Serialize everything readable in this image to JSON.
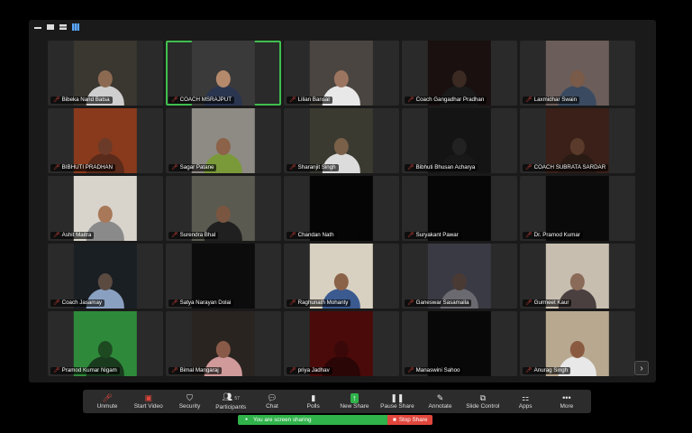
{
  "participants": [
    {
      "name": "Bibeka Nand Batsa",
      "muted": true,
      "video": "#3a3630",
      "skin": "#8c6a52",
      "shirt": "#cfcfcf"
    },
    {
      "name": "COACH MSRAJPUT",
      "muted": true,
      "video": "#3b3a3a",
      "skin": "#b58a6c",
      "shirt": "#2a3550",
      "active": true
    },
    {
      "name": "Lilian Bansal",
      "muted": true,
      "video": "#4a4540",
      "skin": "#9c7560",
      "shirt": "#e8e8e8"
    },
    {
      "name": "Coach Gangadhar Pradhan",
      "muted": true,
      "video": "#1a1010",
      "skin": "#3a2a22",
      "shirt": "#1a1a1a"
    },
    {
      "name": "Laxmidhar Swain",
      "muted": true,
      "video": "#6b5d59",
      "skin": "#7a5a48",
      "shirt": "#3a4a60"
    },
    {
      "name": "BIBHUTI PRADHAN",
      "muted": true,
      "video": "#8a3a1c",
      "skin": "#6b3a28",
      "shirt": "#5a2a1a"
    },
    {
      "name": "Sagar Patane",
      "muted": true,
      "video": "#8e8a84",
      "skin": "#8c6248",
      "shirt": "#7a9a3a"
    },
    {
      "name": "Sharanjit Singh",
      "muted": true,
      "video": "#3a3a30",
      "skin": "#7a6048",
      "shirt": "#dcdcdc"
    },
    {
      "name": "Bibhuti Bhusan Acharya",
      "muted": true,
      "video": "#141414",
      "skin": "#222",
      "shirt": "#181818"
    },
    {
      "name": "COACH SUBRATA SARDAR",
      "muted": true,
      "video": "#3a2018",
      "skin": "#5a3a2a",
      "shirt": "#2a1a14"
    },
    {
      "name": "Ashit Maitra",
      "muted": true,
      "video": "#d8d4cc",
      "skin": "#a87858",
      "shirt": "#8a8a8a"
    },
    {
      "name": "Surendra Bhal",
      "muted": true,
      "video": "#5a5a50",
      "skin": "#7a5640",
      "shirt": "#202020"
    },
    {
      "name": "Chandan Nath",
      "muted": true,
      "video": "#050505",
      "skin": "#050505",
      "shirt": "#050505"
    },
    {
      "name": "Suryakant Pawar",
      "muted": true,
      "video": "#060606",
      "skin": "#060606",
      "shirt": "#060606"
    },
    {
      "name": "Dr. Pramod Kumar",
      "muted": true,
      "video": "#0a0a0a",
      "skin": "#0a0a0a",
      "shirt": "#0a0a0a"
    },
    {
      "name": "Coach Jasamay",
      "muted": true,
      "video": "#1a1f24",
      "skin": "#5a4a40",
      "shirt": "#8aa0c0"
    },
    {
      "name": "Satya Narayan Dolai",
      "muted": true,
      "video": "#0c0c0c",
      "skin": "#0c0c0c",
      "shirt": "#0c0c0c"
    },
    {
      "name": "Raghunath Mohanty",
      "muted": true,
      "video": "#d8d0c0",
      "skin": "#8a6248",
      "shirt": "#3a5a90"
    },
    {
      "name": "Ganeswar Sasamalla",
      "muted": true,
      "video": "#3a3a44",
      "skin": "#4a3a34",
      "shirt": "#6a6a70"
    },
    {
      "name": "Gurmeet Kaur",
      "muted": true,
      "video": "#c8beb0",
      "skin": "#8a6a58",
      "shirt": "#4a4040"
    },
    {
      "name": "Pramod Kumar Nigam",
      "muted": true,
      "video": "#2e8a3a",
      "skin": "#1e4a22",
      "shirt": "#1a3a1e"
    },
    {
      "name": "Bimal Mangaraj",
      "muted": true,
      "video": "#2a2420",
      "skin": "#8a5a48",
      "shirt": "#d09a9a"
    },
    {
      "name": "priya Jadhav",
      "muted": true,
      "video": "#4a0a0a",
      "skin": "#3a0808",
      "shirt": "#2a0606"
    },
    {
      "name": "Manaswini Sahoo",
      "muted": true,
      "video": "#080808",
      "skin": "#080808",
      "shirt": "#080808"
    },
    {
      "name": "Anurag Singh",
      "muted": true,
      "video": "#b8a890",
      "skin": "#8a5a40",
      "shirt": "#e8e8e8"
    }
  ],
  "toolbar": {
    "unmute": "Unmute",
    "start_video": "Start Video",
    "security": "Security",
    "participants": "Participants",
    "participants_count": "57",
    "chat": "Chat",
    "polls": "Polls",
    "new_share": "New Share",
    "pause_share": "Pause Share",
    "annotate": "Annotate",
    "slide_control": "Slide Control",
    "apps": "Apps",
    "more": "More"
  },
  "share_bar": {
    "status": "You are screen sharing",
    "stop": "Stop Share"
  },
  "colors": {
    "active_speaker": "#3fbf4f",
    "mute_red": "#e0463c",
    "share_green": "#2fb34a"
  }
}
